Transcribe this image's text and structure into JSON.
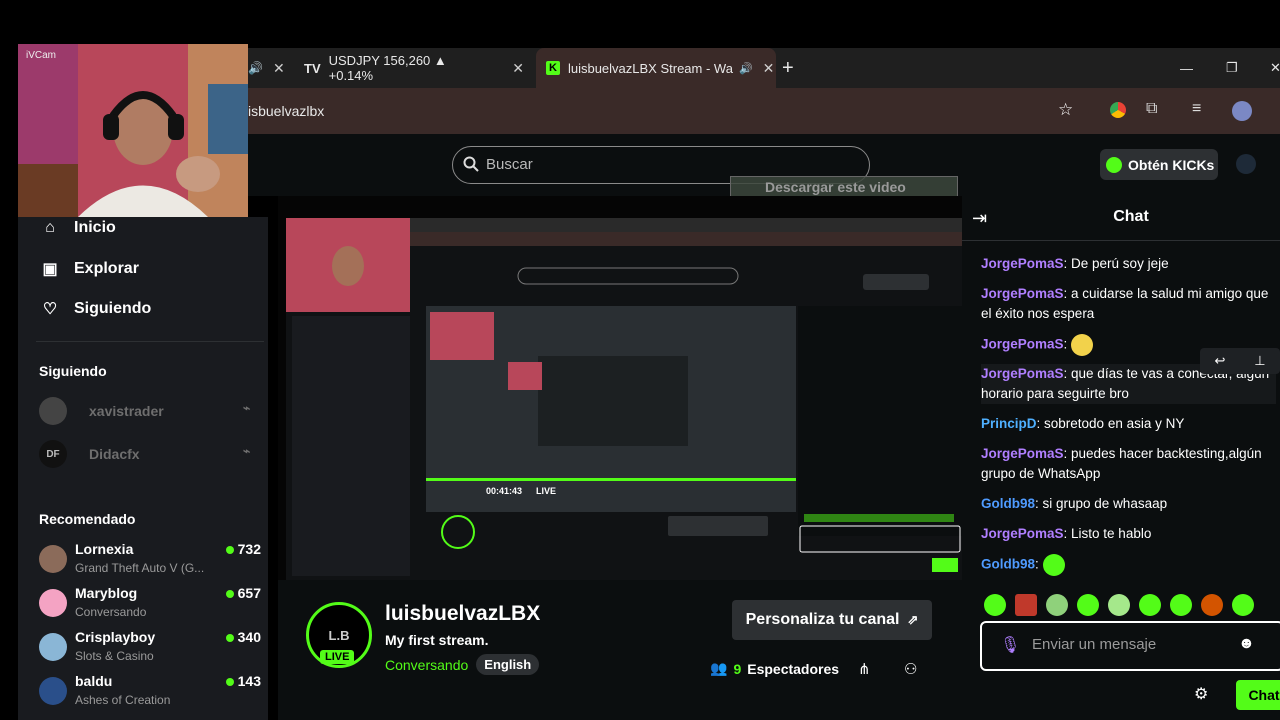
{
  "webcam_label": "iVCam",
  "tabs": [
    {
      "title": "USDJPY 156,260 ▲ +0.14%"
    },
    {
      "title": "luisbuelvazLBX Stream - Wa"
    }
  ],
  "window": {
    "minimize": "—",
    "maximize": "❐",
    "close": "✕"
  },
  "address": {
    "url": "isbuelvazlbx"
  },
  "header": {
    "search_placeholder": "Buscar",
    "get_kicks": "Obtén KICKs",
    "download_overlay": "Descargar este video"
  },
  "sidebar": {
    "nav": [
      {
        "label": "Inicio"
      },
      {
        "label": "Explorar"
      },
      {
        "label": "Siguiendo"
      }
    ],
    "following_title": "Siguiendo",
    "following": [
      {
        "name": "xavistrader",
        "avatar": ""
      },
      {
        "name": "Didacfx",
        "avatar": "DF"
      }
    ],
    "recommended_title": "Recomendado",
    "recommended": [
      {
        "name": "Lornexia",
        "game": "Grand Theft Auto V (G...",
        "viewers": "732",
        "color": "#8b6b5a"
      },
      {
        "name": "Maryblog",
        "game": "Conversando",
        "viewers": "657",
        "color": "#f4a3c3"
      },
      {
        "name": "Crisplayboy",
        "game": "Slots & Casino",
        "viewers": "340",
        "color": "#8ab6d6"
      },
      {
        "name": "baldu",
        "game": "Ashes of Creation",
        "viewers": "143",
        "color": "#2a4f8a"
      }
    ]
  },
  "chat": {
    "title": "Chat",
    "messages": [
      {
        "user": "JorgePomaS",
        "text": ": De perú soy jeje",
        "cls": "u-green"
      },
      {
        "user": "JorgePomaS",
        "text": ": a cuidarse la salud mi amigo que el éxito nos espera",
        "cls": "u-green"
      },
      {
        "user": "JorgePomaS",
        "text": ":",
        "cls": "u-green",
        "emote": "#f2d24b"
      },
      {
        "user": "JorgePomaS",
        "text": ": que días te vas a conectar, algún horario para seguirte bro",
        "cls": "u-green"
      },
      {
        "user": "PrincipD",
        "text": ": sobretodo en asia y NY",
        "cls": "u-cyan"
      },
      {
        "user": "JorgePomaS",
        "text": ": puedes hacer backtesting,algún grupo de WhatsApp",
        "cls": "u-green"
      },
      {
        "user": "Goldb98",
        "text": ": si grupo de whasaap",
        "cls": "u-blue"
      },
      {
        "user": "JorgePomaS",
        "text": ": Listo te hablo",
        "cls": "u-green"
      },
      {
        "user": "Goldb98",
        "text": ":",
        "cls": "u-blue",
        "emote": "#53fc18"
      }
    ],
    "input_placeholder": "Enviar un mensaje",
    "send_label": "Chat"
  },
  "channel": {
    "avatar_text": "L.B",
    "live_badge": "LIVE",
    "name": "luisbuelvazLBX",
    "stream_title": "My first stream.",
    "category": "Conversando",
    "language": "English",
    "customize": "Personaliza tu canal",
    "viewers": "9",
    "viewers_label": "Espectadores"
  },
  "nested": {
    "time": "00:41:43",
    "live": "LIVE"
  },
  "colors": {
    "accent": "#53fc18",
    "bg": "#0b0e0f",
    "sidebar": "#191b1f",
    "address": "#3a2a28"
  }
}
